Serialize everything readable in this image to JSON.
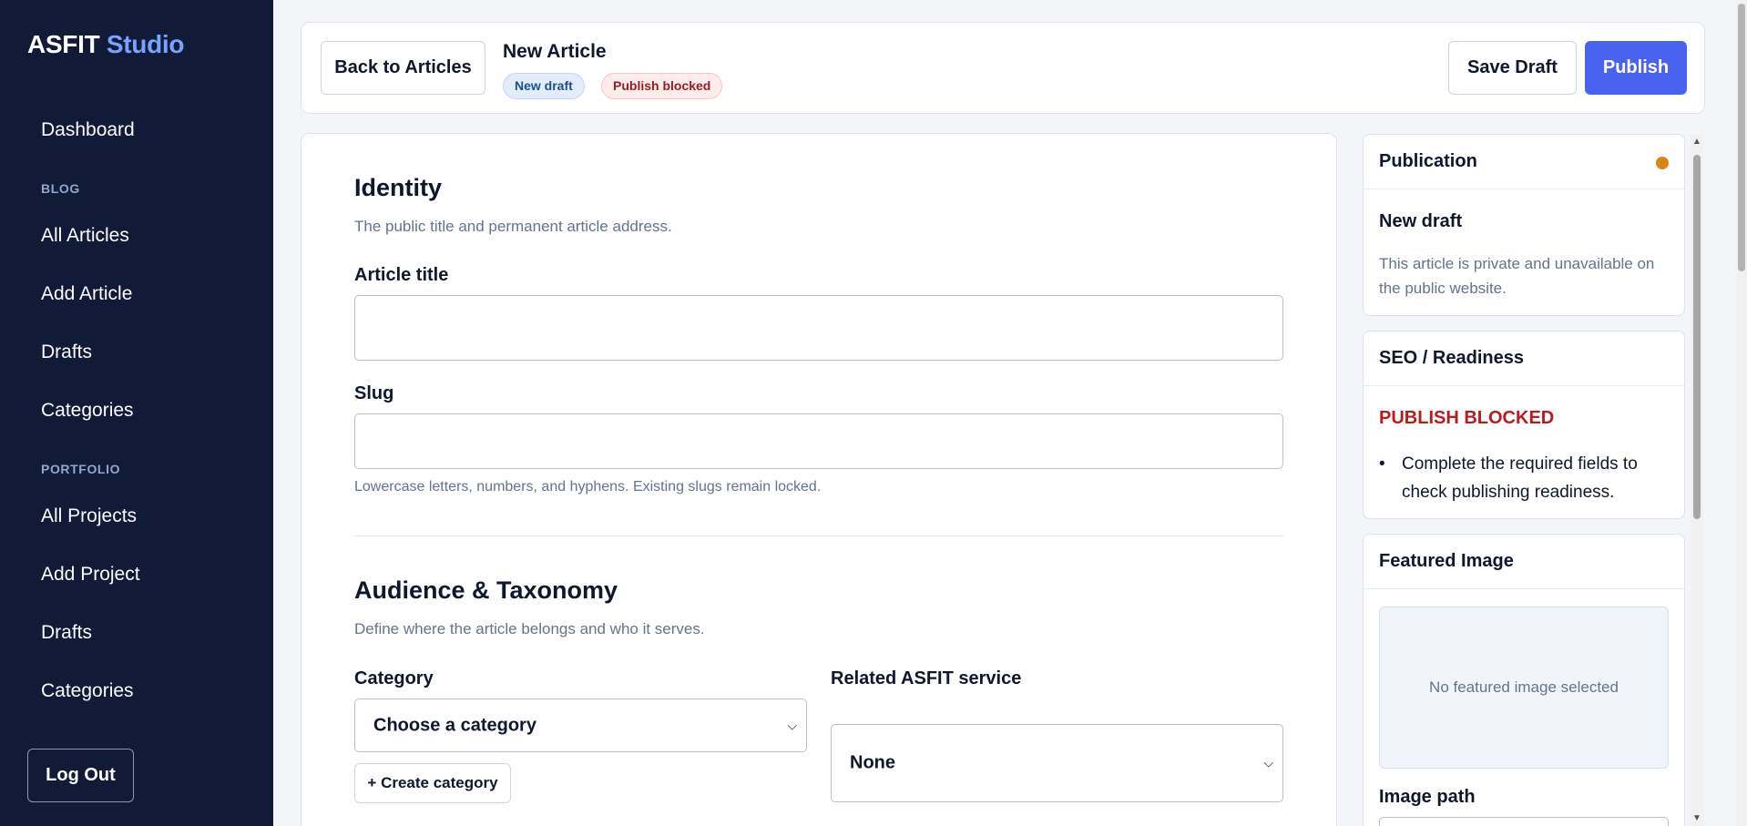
{
  "sidebar": {
    "brand_main": "ASFIT",
    "brand_accent": "Studio",
    "dashboard": "Dashboard",
    "blog_section": "BLOG",
    "blog_items": [
      "All Articles",
      "Add Article",
      "Drafts",
      "Categories"
    ],
    "portfolio_section": "PORTFOLIO",
    "portfolio_items": [
      "All Projects",
      "Add Project",
      "Drafts",
      "Categories"
    ],
    "logout_label": "Log Out"
  },
  "header": {
    "back_label": "Back to Articles",
    "title": "New Article",
    "badge_draft": "New draft",
    "badge_blocked": "Publish blocked",
    "save_label": "Save Draft",
    "publish_label": "Publish"
  },
  "identity": {
    "title": "Identity",
    "description": "The public title and permanent article address.",
    "article_title_label": "Article title",
    "article_title_value": "",
    "slug_label": "Slug",
    "slug_value": "",
    "slug_hint": "Lowercase letters, numbers, and hyphens. Existing slugs remain locked."
  },
  "taxonomy": {
    "title": "Audience & Taxonomy",
    "description": "Define where the article belongs and who it serves.",
    "category_label": "Category",
    "category_value": "Choose a category",
    "create_category_label": "+ Create category",
    "service_label": "Related ASFIT service",
    "service_value": "None"
  },
  "publication": {
    "title": "Publication",
    "state": "New draft",
    "description": "This article is private and unavailable on the public website."
  },
  "seo": {
    "title": "SEO / Readiness",
    "status": "PUBLISH BLOCKED",
    "items": [
      "Complete the required fields to check publishing readiness."
    ]
  },
  "featured_image": {
    "title": "Featured Image",
    "placeholder": "No featured image selected",
    "path_label": "Image path"
  },
  "colors": {
    "sidebar_bg": "#111a36",
    "brand_accent": "#7aa2ff",
    "publish_button": "#4a63ee",
    "blocked_text": "#b91c1c",
    "status_dot": "#d9851a"
  },
  "icons": {
    "chevron": "chevron-down-icon",
    "status": "status-dot-icon"
  }
}
